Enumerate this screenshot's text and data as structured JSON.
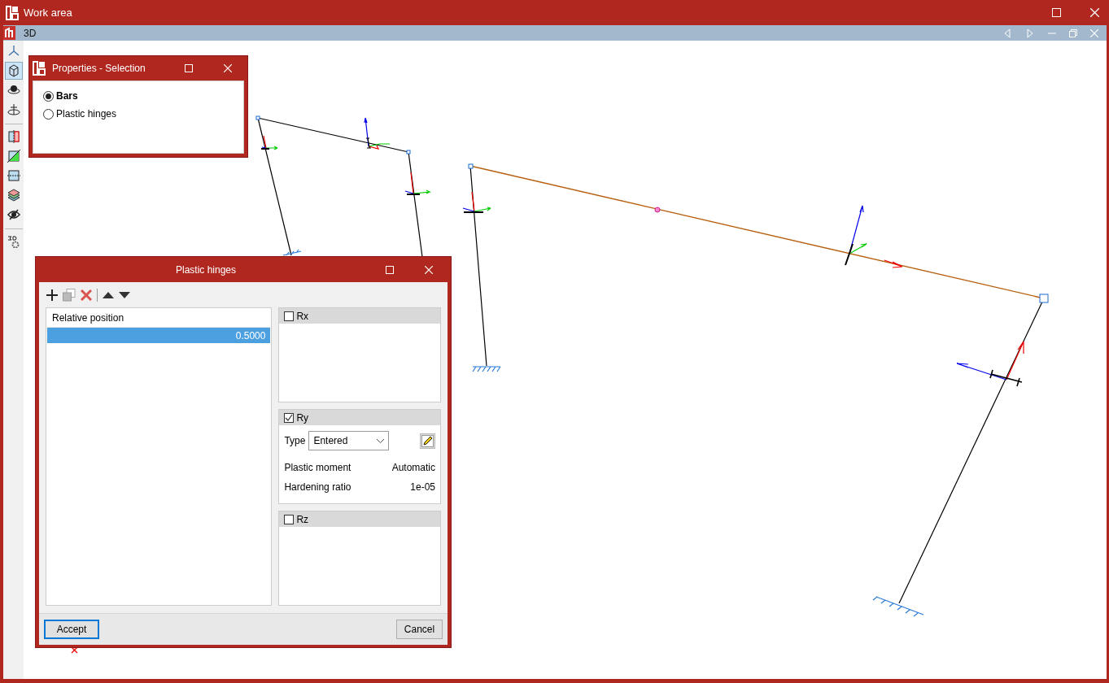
{
  "window": {
    "title": "Work area"
  },
  "view": {
    "title": "3D"
  },
  "toolbar": [
    [
      {
        "kind": "axes",
        "selected": false
      },
      {
        "kind": "cube",
        "selected": true
      },
      {
        "kind": "orbit",
        "selected": false
      },
      {
        "kind": "spin",
        "selected": false
      }
    ],
    [
      {
        "kind": "section-red",
        "selected": false
      },
      {
        "kind": "section-green",
        "selected": false
      },
      {
        "kind": "section-blue",
        "selected": false
      },
      {
        "kind": "layers",
        "selected": false
      },
      {
        "kind": "hide",
        "selected": false
      }
    ],
    [
      {
        "kind": "settings3d",
        "selected": false
      }
    ]
  ],
  "properties_dialog": {
    "title": "Properties - Selection",
    "options": [
      {
        "label": "Bars",
        "selected": true
      },
      {
        "label": "Plastic hinges",
        "selected": false
      }
    ]
  },
  "hinges_dialog": {
    "title": "Plastic hinges",
    "table": {
      "columns": [
        "Relative position"
      ],
      "rows": [
        {
          "value": "0.5000",
          "selected": true
        }
      ]
    },
    "rotations": [
      {
        "label": "Rx",
        "checked": false
      },
      {
        "label": "Ry",
        "checked": true,
        "type_label": "Type",
        "type_value": "Entered",
        "properties": [
          {
            "label": "Plastic moment",
            "value": "Automatic"
          },
          {
            "label": "Hardening ratio",
            "value": "1e-05"
          }
        ]
      },
      {
        "label": "Rz",
        "checked": false
      }
    ],
    "buttons": [
      {
        "label": "Accept",
        "kind": "default"
      },
      {
        "label": "Cancel",
        "kind": "normal"
      }
    ]
  }
}
